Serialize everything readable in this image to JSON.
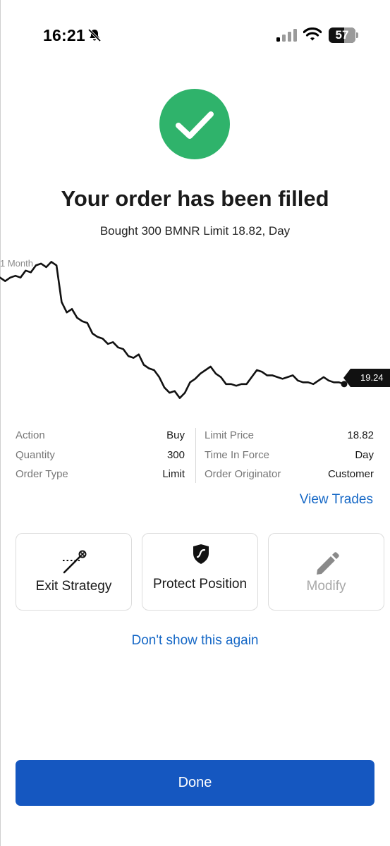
{
  "status_bar": {
    "time": "16:21",
    "battery_level": "57",
    "icons": [
      "bell-slash-icon",
      "cellular-signal-icon",
      "wifi-icon",
      "battery-icon"
    ]
  },
  "confirmation": {
    "icon": "check-circle-icon",
    "icon_color": "#2fb36b",
    "title": "Your order has been filled",
    "subtitle": "Bought 300 BMNR Limit 18.82, Day"
  },
  "chart": {
    "period_label": "1 Month",
    "last_price_label": "19.24"
  },
  "chart_data": {
    "type": "line",
    "title": "",
    "period": "1 Month",
    "last_price": 19.24,
    "series": [
      {
        "values": [
          22.2,
          22.0,
          22.2,
          22.3,
          22.2,
          22.6,
          22.5,
          22.9,
          23.0,
          22.8,
          23.1,
          22.9,
          20.8,
          20.2,
          20.4,
          19.9,
          19.7,
          19.6,
          19.0,
          18.8,
          18.7,
          18.4,
          18.5,
          18.2,
          18.1,
          17.7,
          17.6,
          17.8,
          17.2,
          17.0,
          16.9,
          16.5,
          15.9,
          15.6,
          15.7,
          15.3,
          15.6,
          16.2,
          16.4,
          16.7,
          16.9,
          17.1,
          16.7,
          16.5,
          16.1,
          16.1,
          16.0,
          16.1,
          16.1,
          16.5,
          16.9,
          16.8,
          16.6,
          16.6,
          16.5,
          16.4,
          16.5,
          16.6,
          16.3,
          16.2,
          16.2,
          16.1,
          16.3,
          16.5,
          16.3,
          16.2,
          16.2,
          16.1
        ]
      }
    ],
    "line_color": "#111111"
  },
  "order_details": {
    "left": [
      {
        "label": "Action",
        "value": "Buy"
      },
      {
        "label": "Quantity",
        "value": "300"
      },
      {
        "label": "Order Type",
        "value": "Limit"
      }
    ],
    "right": [
      {
        "label": "Limit Price",
        "value": "18.82"
      },
      {
        "label": "Time In Force",
        "value": "Day"
      },
      {
        "label": "Order Originator",
        "value": "Customer"
      }
    ]
  },
  "links": {
    "view_trades": "View Trades",
    "dont_show": "Don't show this again"
  },
  "actions": [
    {
      "label": "Exit Strategy",
      "icon": "exit-strategy-icon",
      "enabled": true
    },
    {
      "label": "Protect Position",
      "icon": "shield-icon",
      "enabled": true
    },
    {
      "label": "Modify",
      "icon": "pencil-icon",
      "enabled": false
    }
  ],
  "done_button": {
    "label": "Done",
    "color": "#1557c0"
  },
  "colors": {
    "link": "#1668c6",
    "success": "#2fb36b"
  }
}
